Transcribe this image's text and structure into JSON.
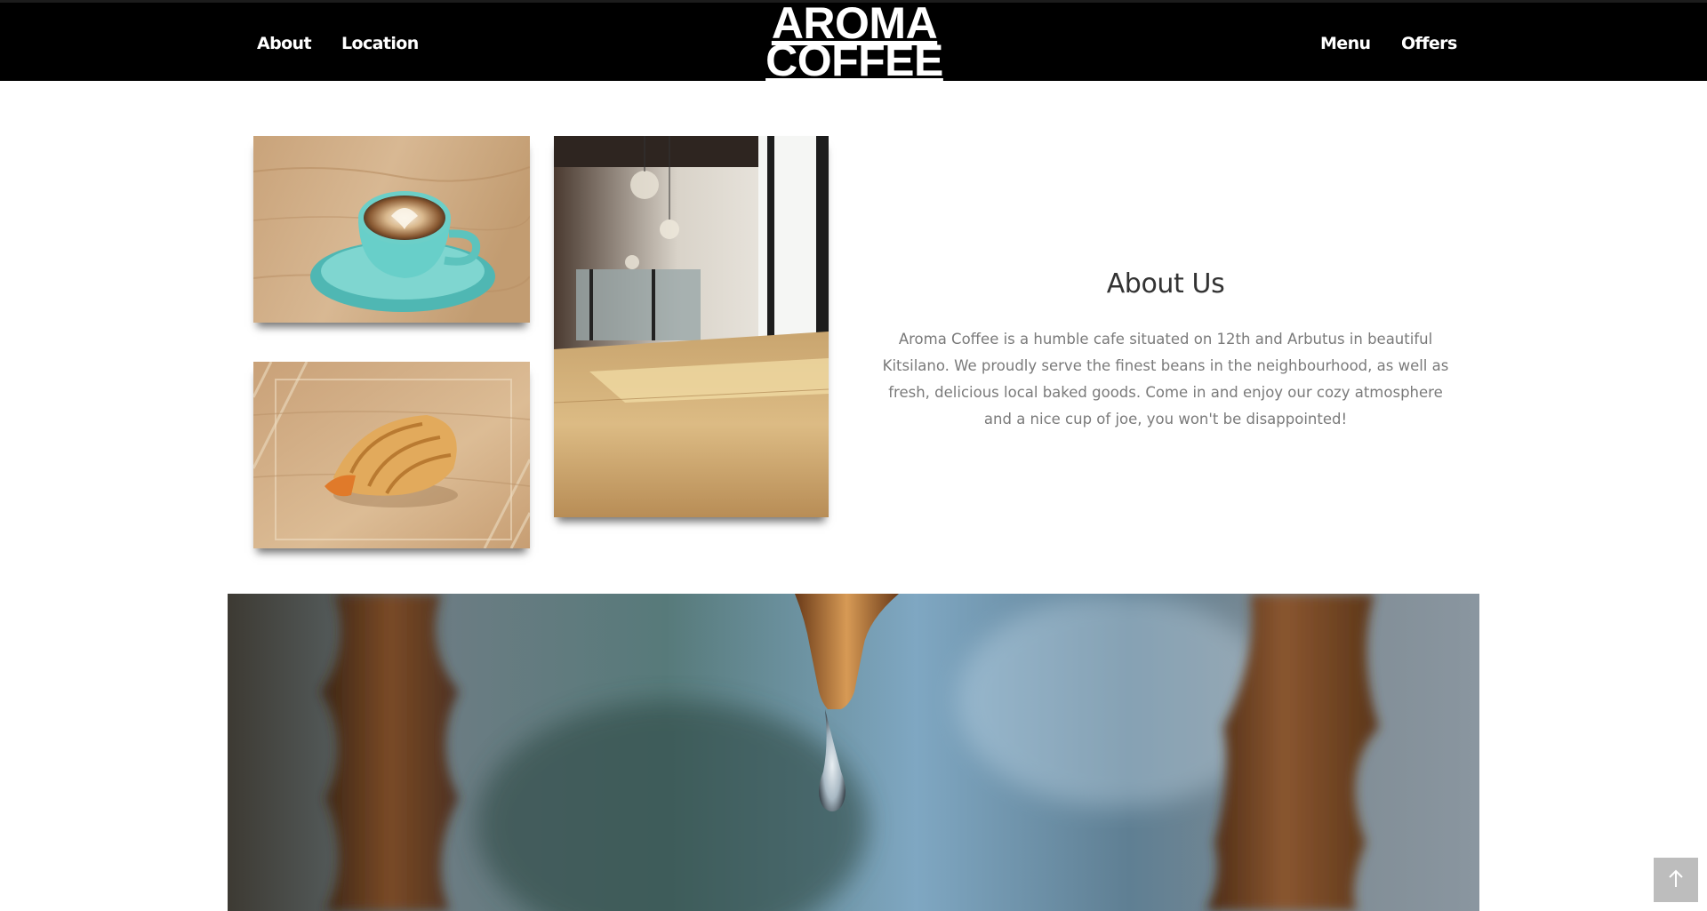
{
  "nav": {
    "left_links": [
      "About",
      "Location"
    ],
    "right_links": [
      "Menu",
      "Offers"
    ]
  },
  "logo": {
    "line1": "AROMA",
    "line2": "COFFEE"
  },
  "about": {
    "title": "About Us",
    "text": "Aroma Coffee is a humble cafe situated on 12th and Arbutus in beautiful Kitsilano. We proudly serve the finest beans in the neighbourhood, as well as fresh, delicious local baked goods. Come in and enjoy our cozy atmosphere and a nice cup of joe, you won't be disappointed!"
  },
  "images": {
    "latte": "latte-photo",
    "croissant": "croissant-photo",
    "counter": "cafe-counter-photo",
    "banner": "coffee-drip-photo"
  },
  "back_to_top": {
    "icon": "arrow-up-icon"
  },
  "colors": {
    "nav_bg": "#000000",
    "nav_text": "#ffffff",
    "heading": "#333333",
    "body_text": "#7a7a7a",
    "back_to_top_bg": "#bdbdbd"
  }
}
